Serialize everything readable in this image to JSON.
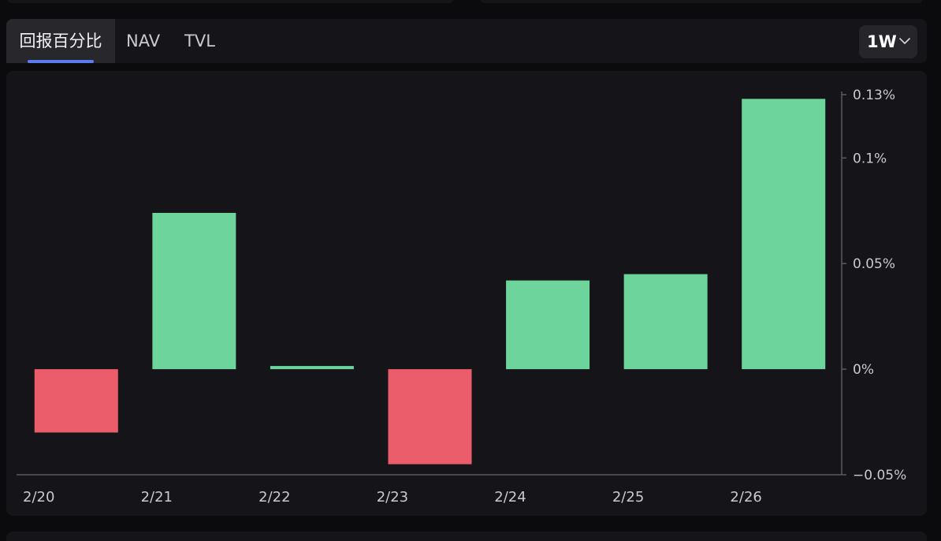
{
  "tabs": [
    {
      "label": "回报百分比",
      "active": true
    },
    {
      "label": "NAV",
      "active": false
    },
    {
      "label": "TVL",
      "active": false
    }
  ],
  "range_select": {
    "value": "1W"
  },
  "colors": {
    "positive": "#6dd49b",
    "negative": "#eb5d6a",
    "accent": "#5b7cf0",
    "panel": "#151519"
  },
  "chart_data": {
    "type": "bar",
    "categories": [
      "2/20",
      "2/21",
      "2/22",
      "2/23",
      "2/24",
      "2/25",
      "2/26"
    ],
    "values": [
      -0.03,
      0.074,
      0.0015,
      -0.045,
      0.042,
      0.045,
      0.128
    ],
    "ylim": [
      -0.05,
      0.13
    ],
    "y_ticks": [
      0.13,
      0.1,
      0.05,
      0,
      -0.05
    ],
    "y_tick_labels": [
      "0.13%",
      "0.1%",
      "0.05%",
      "0%",
      "−0.05%"
    ],
    "y_axis_position": "right",
    "grid": false,
    "legend": "none"
  }
}
